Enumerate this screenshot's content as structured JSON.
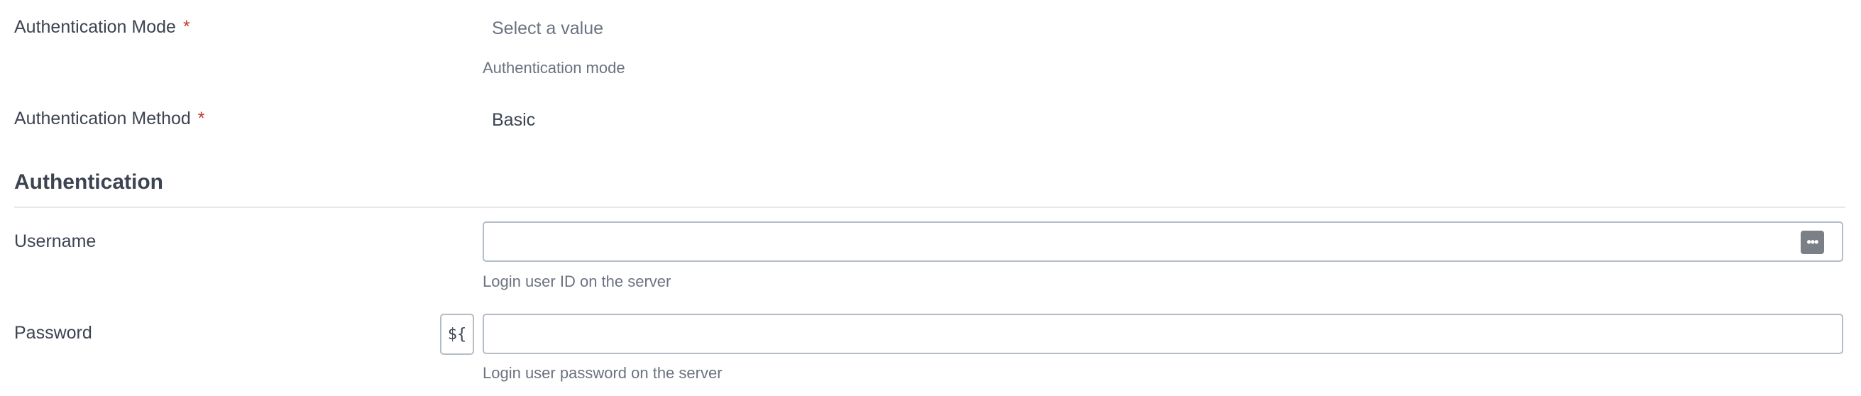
{
  "auth_mode": {
    "label": "Authentication Mode",
    "required_mark": "*",
    "value_placeholder": "Select a value",
    "help": "Authentication mode"
  },
  "auth_method": {
    "label": "Authentication Method",
    "required_mark": "*",
    "value": "Basic"
  },
  "section": {
    "title": "Authentication"
  },
  "username": {
    "label": "Username",
    "value": "",
    "help": "Login user ID on the server",
    "action_icon": "ellipsis-icon",
    "action_glyph": "•••"
  },
  "password": {
    "label": "Password",
    "value": "",
    "variable_button": "${",
    "help": "Login user password on the server"
  },
  "colors": {
    "required": "#c0392b",
    "border": "#b4bcc6",
    "text": "#3d4451",
    "muted": "#6b7280"
  }
}
